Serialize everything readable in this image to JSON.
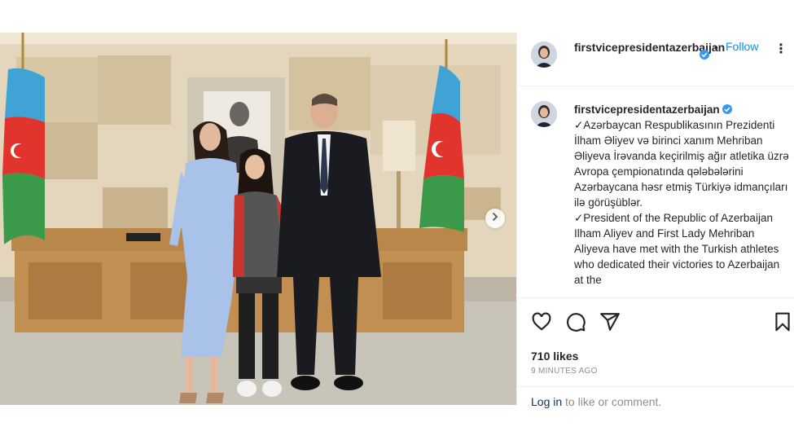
{
  "colors": {
    "accent": "#0095f6",
    "verified": "#3897f0",
    "text": "#262626",
    "muted": "#8e8e8e"
  },
  "header": {
    "username": "firstvicepresidentazerbaijan",
    "separator": "•",
    "follow_label": "Follow",
    "more_icon": "more-horizontal-icon",
    "more_label": "⋮"
  },
  "media": {
    "next_icon": "chevron-right-icon"
  },
  "caption": {
    "username": "firstvicepresidentazerbaijan",
    "text": "✓Azərbaycan Respublikasının Prezidenti İlham Əliyev və birinci xanım Mehriban Əliyeva İrəvanda keçirilmiş ağır atletika üzrə Avropa çempionatında qələbələrini Azərbaycana həsr etmiş Türkiyə idmançıları ilə görüşüblər.\n✓President of the Republic of Azerbaijan Ilham Aliyev and First Lady Mehriban Aliyeva have met with the Turkish athletes who dedicated their victories to Azerbaijan at the"
  },
  "actions": {
    "like_icon": "heart-icon",
    "comment_icon": "comment-icon",
    "share_icon": "share-icon",
    "save_icon": "bookmark-icon"
  },
  "likes": "710 likes",
  "timestamp": "9 MINUTES AGO",
  "login": {
    "link": "Log in",
    "rest": " to like or comment."
  }
}
